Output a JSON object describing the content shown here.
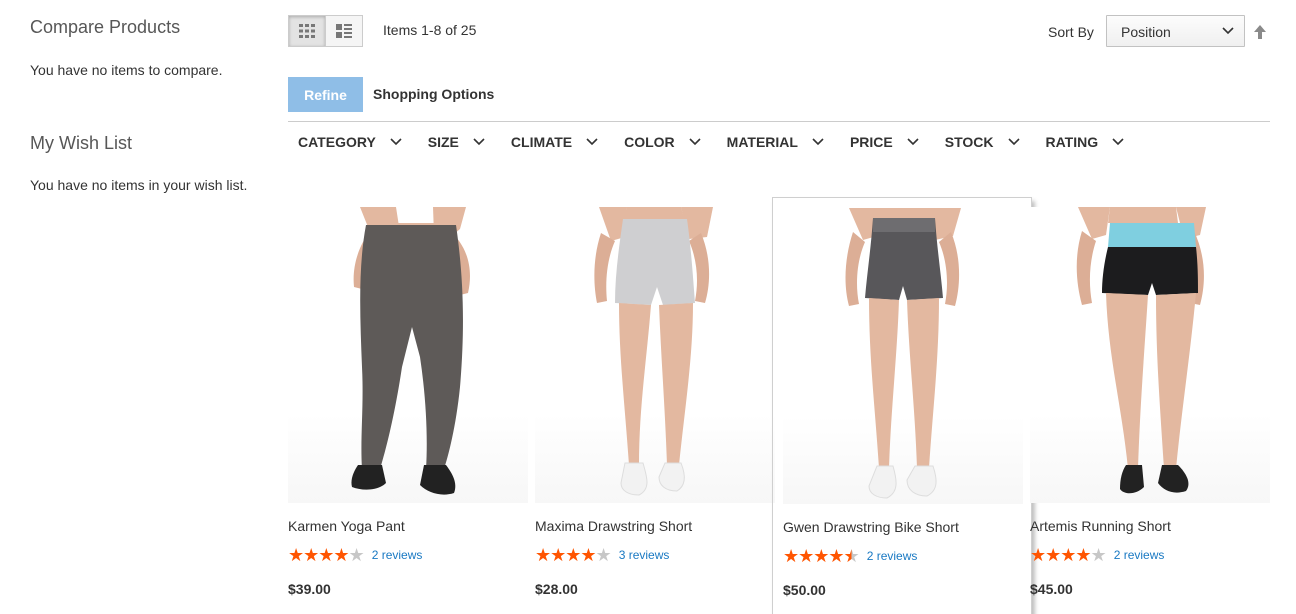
{
  "sidebar": {
    "compare": {
      "title": "Compare Products",
      "empty": "You have no items to compare."
    },
    "wishlist": {
      "title": "My Wish List",
      "empty": "You have no items in your wish list."
    }
  },
  "toolbar": {
    "mode_grid_icon": "grid-icon",
    "mode_list_icon": "list-icon",
    "amount": "Items 1-8 of 25",
    "sort_label": "Sort By",
    "sort_value": "Position",
    "sort_direction_icon": "arrow-up-icon"
  },
  "refine": {
    "button": "Refine",
    "title": "Shopping Options",
    "filters": [
      "CATEGORY",
      "SIZE",
      "CLIMATE",
      "COLOR",
      "MATERIAL",
      "PRICE",
      "STOCK",
      "RATING"
    ]
  },
  "colors": {
    "accent": "#8fbee7",
    "star": "#ff5501",
    "link": "#1979c3"
  },
  "products": [
    {
      "name": "Karmen Yoga Pant",
      "rating_stars": 4,
      "reviews": "2 reviews",
      "price": "$39.00"
    },
    {
      "name": "Maxima Drawstring Short",
      "rating_stars": 4,
      "reviews": "3 reviews",
      "price": "$28.00"
    },
    {
      "name": "Gwen Drawstring Bike Short",
      "rating_stars": 4.5,
      "reviews": "2 reviews",
      "price": "$50.00"
    },
    {
      "name": "Artemis Running Short",
      "rating_stars": 4,
      "reviews": "2 reviews",
      "price": "$45.00"
    }
  ]
}
